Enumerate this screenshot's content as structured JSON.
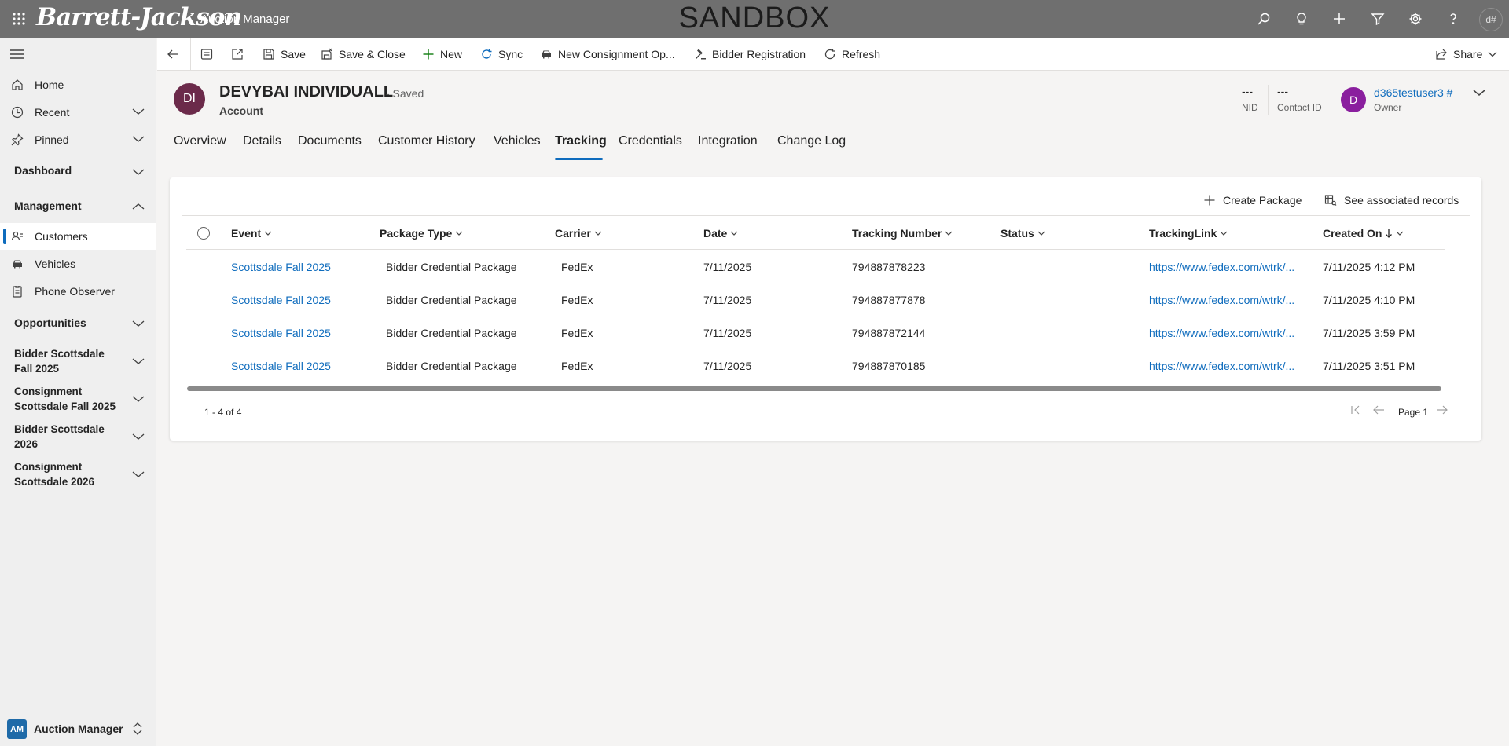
{
  "top_bar": {
    "logo_text": "Barrett-Jackson",
    "app_title": "Auction Manager",
    "environment_banner": "SANDBOX",
    "icons": [
      "search-icon",
      "lightbulb-icon",
      "plus-icon",
      "filter-icon",
      "gear-icon",
      "help-icon"
    ],
    "user_initials": "d#"
  },
  "sidebar": {
    "items": [
      {
        "label": "Home",
        "icon": "home-icon"
      },
      {
        "label": "Recent",
        "icon": "clock-icon"
      },
      {
        "label": "Pinned",
        "icon": "pin-icon"
      }
    ],
    "groups": {
      "dashboard": "Dashboard",
      "management": "Management",
      "opportunities": "Opportunities",
      "bidder_fall_2025": "Bidder Scottsdale Fall 2025",
      "consignment_fall_2025": "Consignment Scottsdale Fall 2025",
      "bidder_2026": "Bidder Scottsdale 2026",
      "consignment_2026": "Consignment Scottsdale 2026"
    },
    "management_items": [
      {
        "label": "Customers",
        "icon": "contacts-icon",
        "selected": true
      },
      {
        "label": "Vehicles",
        "icon": "car-icon"
      },
      {
        "label": "Phone Observer",
        "icon": "phone-list-icon"
      }
    ],
    "area": {
      "badge": "AM",
      "label": "Auction Manager"
    }
  },
  "command_bar": {
    "save": "Save",
    "save_close": "Save & Close",
    "new": "New",
    "sync": "Sync",
    "new_consignment": "New Consignment Op...",
    "bidder_registration": "Bidder Registration",
    "refresh": "Refresh",
    "share": "Share"
  },
  "record": {
    "initials": "DI",
    "name": "DEVYBAI INDIVIDUALL",
    "save_state": "- Saved",
    "entity": "Account",
    "nid_value": "---",
    "nid_label": "NID",
    "contact_id_value": "---",
    "contact_id_label": "Contact ID",
    "owner_initial": "D",
    "owner_name": "d365testuser3 #",
    "owner_label": "Owner"
  },
  "tabs": [
    "Overview",
    "Details",
    "Documents",
    "Customer History",
    "Vehicles",
    "Tracking",
    "Credentials",
    "Integration",
    "Change Log"
  ],
  "active_tab": "Tracking",
  "subgrid": {
    "create_package": "Create Package",
    "see_associated": "See associated records",
    "columns": [
      "Event",
      "Package Type",
      "Carrier",
      "Date",
      "Tracking Number",
      "Status",
      "TrackingLink",
      "Created On"
    ],
    "sort_column": "Created On",
    "rows": [
      {
        "event": "Scottsdale Fall 2025",
        "package_type": "Bidder Credential Package",
        "carrier": "FedEx",
        "date": "7/11/2025",
        "tracking_number": "794887878223",
        "status": "",
        "link": "https://www.fedex.com/wtrk/...",
        "created_on": "7/11/2025 4:12 PM"
      },
      {
        "event": "Scottsdale Fall 2025",
        "package_type": "Bidder Credential Package",
        "carrier": "FedEx",
        "date": "7/11/2025",
        "tracking_number": "794887877878",
        "status": "",
        "link": "https://www.fedex.com/wtrk/...",
        "created_on": "7/11/2025 4:10 PM"
      },
      {
        "event": "Scottsdale Fall 2025",
        "package_type": "Bidder Credential Package",
        "carrier": "FedEx",
        "date": "7/11/2025",
        "tracking_number": "794887872144",
        "status": "",
        "link": "https://www.fedex.com/wtrk/...",
        "created_on": "7/11/2025 3:59 PM"
      },
      {
        "event": "Scottsdale Fall 2025",
        "package_type": "Bidder Credential Package",
        "carrier": "FedEx",
        "date": "7/11/2025",
        "tracking_number": "794887870185",
        "status": "",
        "link": "https://www.fedex.com/wtrk/...",
        "created_on": "7/11/2025 3:51 PM"
      }
    ],
    "record_count": "1 - 4 of 4",
    "page_label": "Page 1"
  },
  "colors": {
    "accent": "#0f6cbd",
    "top_bar": "#6f6f6f",
    "record_avatar": "#6b2a4a",
    "owner_avatar": "#8a1f9e"
  }
}
